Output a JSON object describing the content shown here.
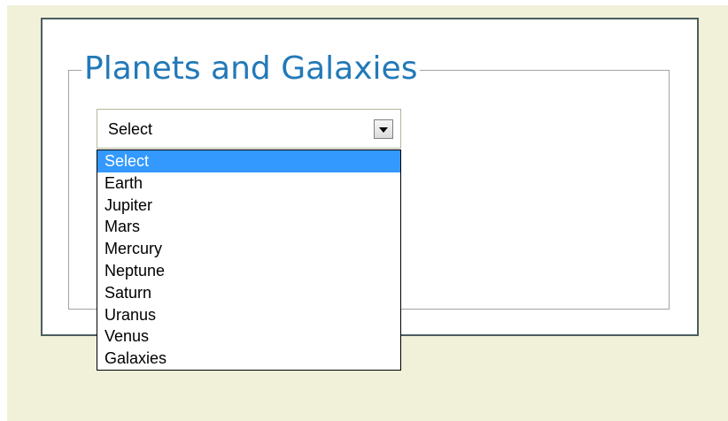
{
  "fieldset": {
    "legend": "Planets and Galaxies"
  },
  "select": {
    "value": "Select",
    "options": [
      {
        "label": "Select",
        "selected": true
      },
      {
        "label": "Earth",
        "selected": false
      },
      {
        "label": "Jupiter",
        "selected": false
      },
      {
        "label": "Mars",
        "selected": false
      },
      {
        "label": "Mercury",
        "selected": false
      },
      {
        "label": "Neptune",
        "selected": false
      },
      {
        "label": "Saturn",
        "selected": false
      },
      {
        "label": "Uranus",
        "selected": false
      },
      {
        "label": "Venus",
        "selected": false
      },
      {
        "label": "Galaxies",
        "selected": false
      }
    ]
  },
  "icons": {
    "dropdown": "chevron-down-icon"
  },
  "colors": {
    "page_background": "#f1f0d9",
    "panel_border": "#4b5d5e",
    "legend_text": "#2279b8",
    "selected_option_bg": "#3399ff",
    "selected_option_text": "#ffffff"
  }
}
